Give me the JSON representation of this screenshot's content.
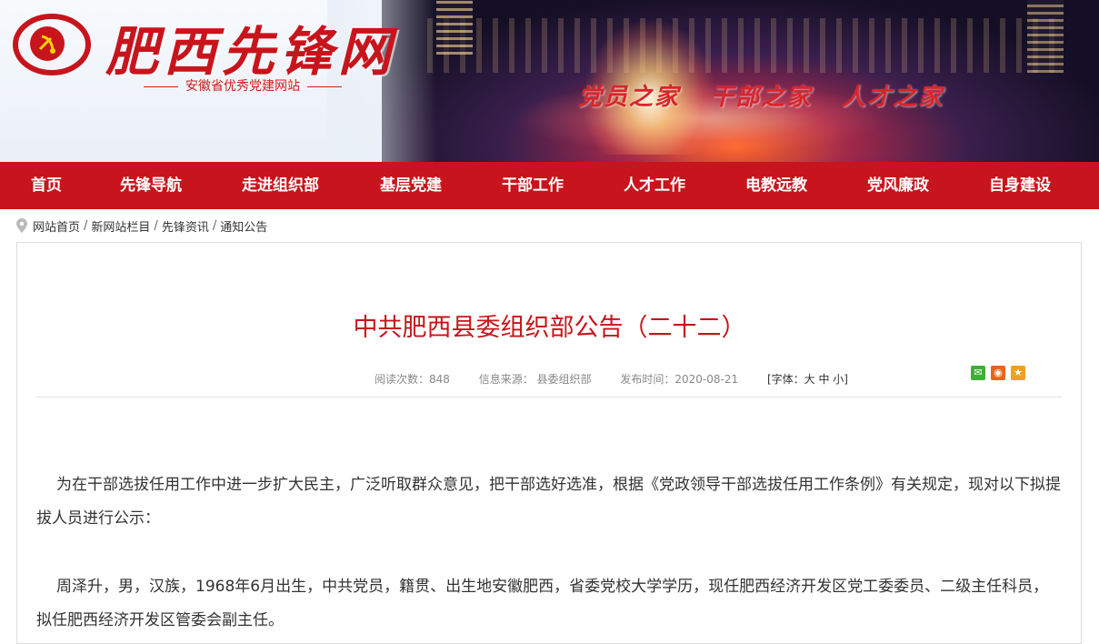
{
  "site": {
    "logo_text": "肥西先锋网",
    "subtitle": "安徽省优秀党建网站",
    "slogans": [
      "党员之家",
      "干部之家",
      "人才之家"
    ],
    "emblem_url_text": "www.ahxf.gov.cn"
  },
  "nav": {
    "items": [
      "首页",
      "先锋导航",
      "走进组织部",
      "基层党建",
      "干部工作",
      "人才工作",
      "电教远教",
      "党风廉政",
      "自身建设"
    ]
  },
  "breadcrumb": {
    "items": [
      "网站首页",
      "新网站栏目",
      "先锋资讯",
      "通知公告"
    ],
    "separator": "/"
  },
  "article": {
    "title": "中共肥西县委组织部公告（二十二）",
    "views": "阅读次数：848",
    "source": "信息来源： 县委组织部",
    "published": "发布时间：2020-08-21",
    "font_size": "[字体：大 中 小]",
    "paragraphs": [
      "为在干部选拔任用工作中进一步扩大民主，广泛听取群众意见，把干部选好选准，根据《党政领导干部选拔任用工作条例》有关规定，现对以下拟提拔人员进行公示：",
      "周泽升，男，汉族，1968年6月出生，中共党员，籍贯、出生地安徽肥西，省委党校大学学历，现任肥西经济开发区党工委委员、二级主任科员，拟任肥西经济开发区管委会副主任。"
    ]
  },
  "share": {
    "icons": [
      "wechat-icon",
      "weibo-icon",
      "favorite-icon"
    ]
  },
  "colors": {
    "brand_red": "#c8141c",
    "wechat_green": "#3cb035",
    "weibo_orange": "#e8641b",
    "fav_orange": "#f0a020"
  }
}
